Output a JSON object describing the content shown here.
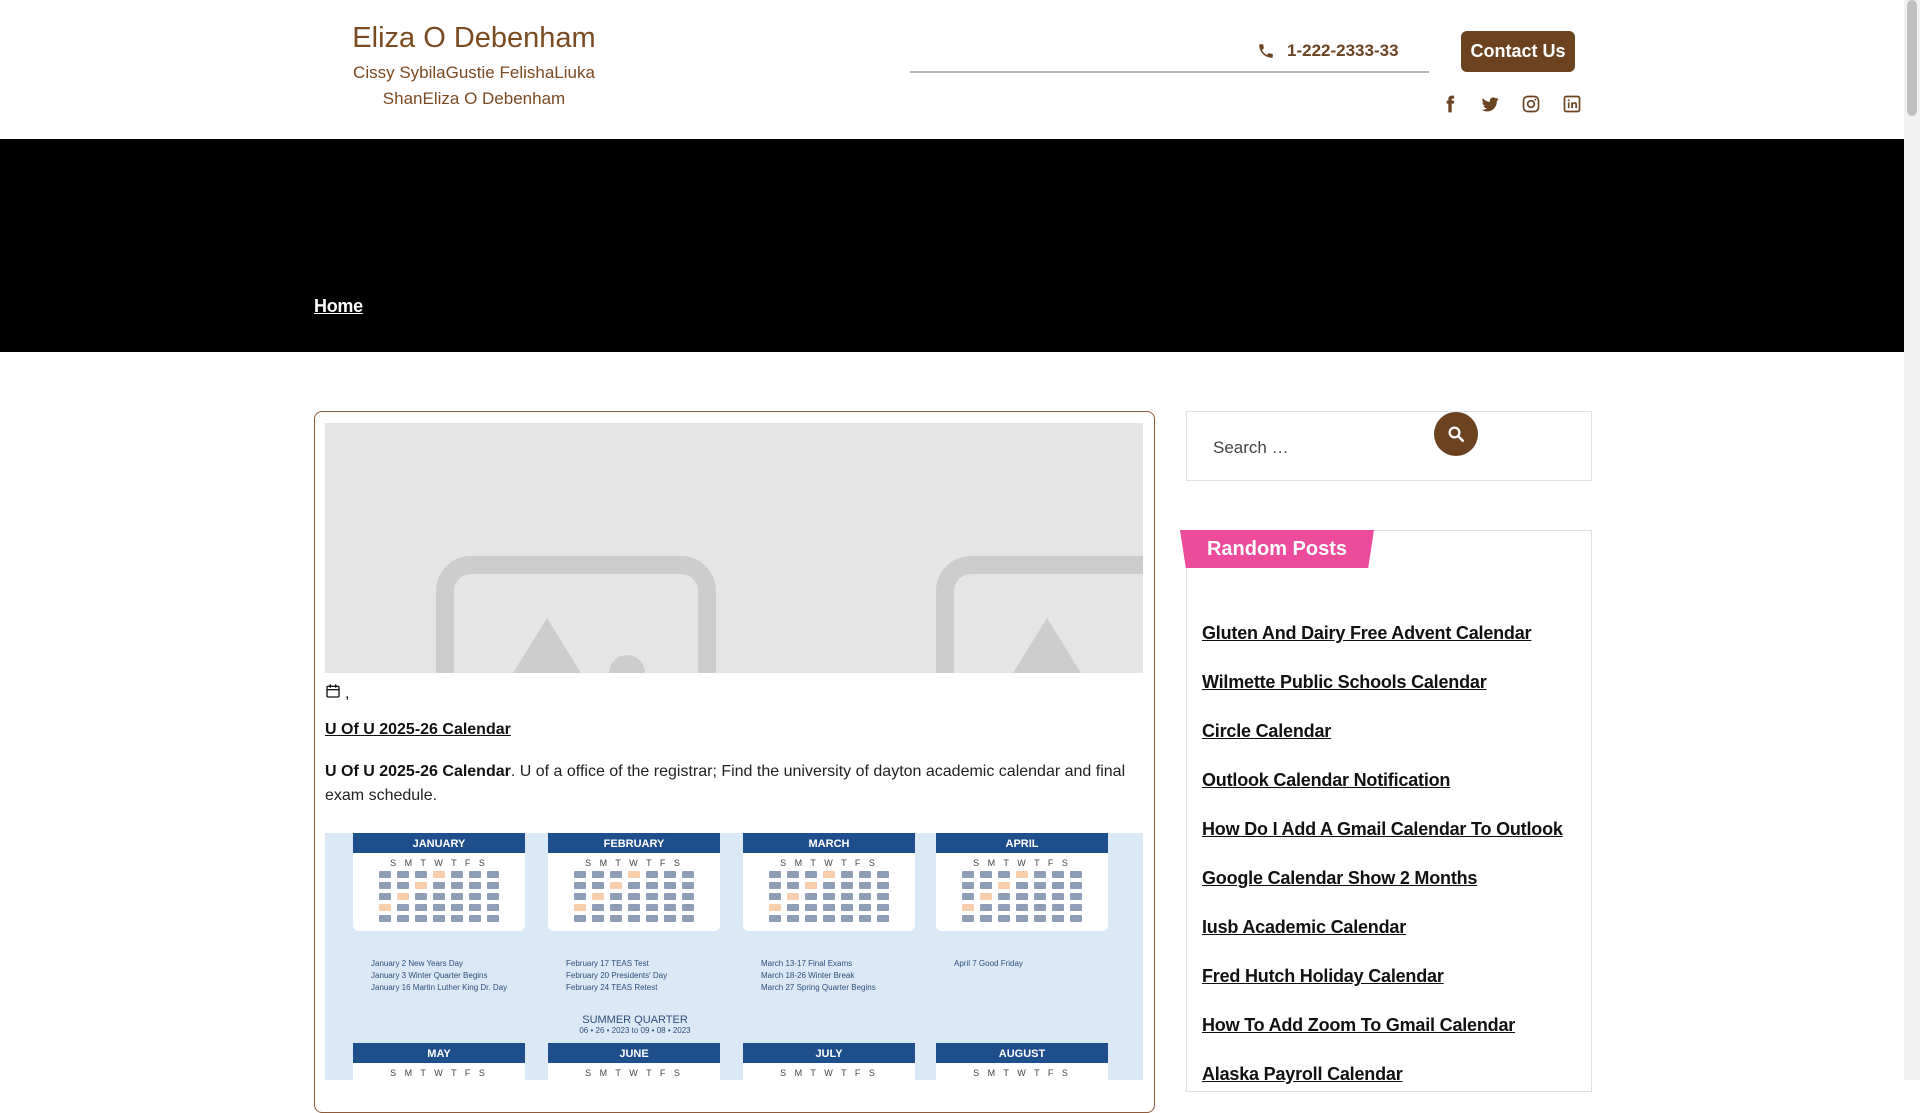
{
  "header": {
    "site_title": "Eliza O Debenham",
    "tagline": "Cissy SybilaGustie FelishaLiuka ShanEliza O Debenham",
    "phone": "1-222-2333-33",
    "contact_button": "Contact Us",
    "social_icons": [
      "facebook-icon",
      "twitter-icon",
      "instagram-icon",
      "linkedin-icon"
    ]
  },
  "hero": {
    "breadcrumb_home": "Home"
  },
  "post": {
    "date_text": ",",
    "title": "U Of U 2025-26 Calendar",
    "excerpt_bold": "U Of U 2025-26 Calendar",
    "excerpt_rest": ". U of a office of the registrar; Find the university of dayton academic calendar and final exam schedule.",
    "calendar_months_top": [
      "JANUARY",
      "FEBRUARY",
      "MARCH",
      "APRIL"
    ],
    "calendar_months_bottom": [
      "MAY",
      "JUNE",
      "JULY",
      "AUGUST"
    ],
    "calendar_weekdays": "S M T W T F S",
    "calendar_notes": {
      "january": [
        "January 2 New Years Day",
        "January 3 Winter Quarter Begins",
        "January 16 Martin Luther King Dr. Day"
      ],
      "february": [
        "February 17 TEAS Test",
        "February 20 Presidents' Day",
        "February 24 TEAS Retest"
      ],
      "march": [
        "March 13-17 Final Exams",
        "March 18-26 Winter Break",
        "March 27 Spring Quarter Begins"
      ],
      "april": [
        "April 7 Good Friday"
      ]
    },
    "summer_quarter": "SUMMER QUARTER",
    "summer_dates": "06 • 26 • 2023 to 09 • 08 • 2023"
  },
  "sidebar": {
    "search_placeholder": "Search …",
    "random_posts_title": "Random Posts",
    "random_posts": [
      "Gluten And Dairy Free Advent Calendar",
      "Wilmette Public Schools Calendar",
      "Circle Calendar",
      "Outlook Calendar Notification",
      "How Do I Add A Gmail Calendar To Outlook",
      "Google Calendar Show 2 Months",
      "Iusb Academic Calendar",
      "Fred Hutch Holiday Calendar",
      "How To Add Zoom To Gmail Calendar",
      "Alaska Payroll Calendar"
    ]
  },
  "colors": {
    "brand_brown": "#6b4320",
    "title_brown": "#7a4a21",
    "accent_pink": "#ec4c9b",
    "hero_bg": "#000000",
    "calendar_blue": "#1e4e8c"
  }
}
